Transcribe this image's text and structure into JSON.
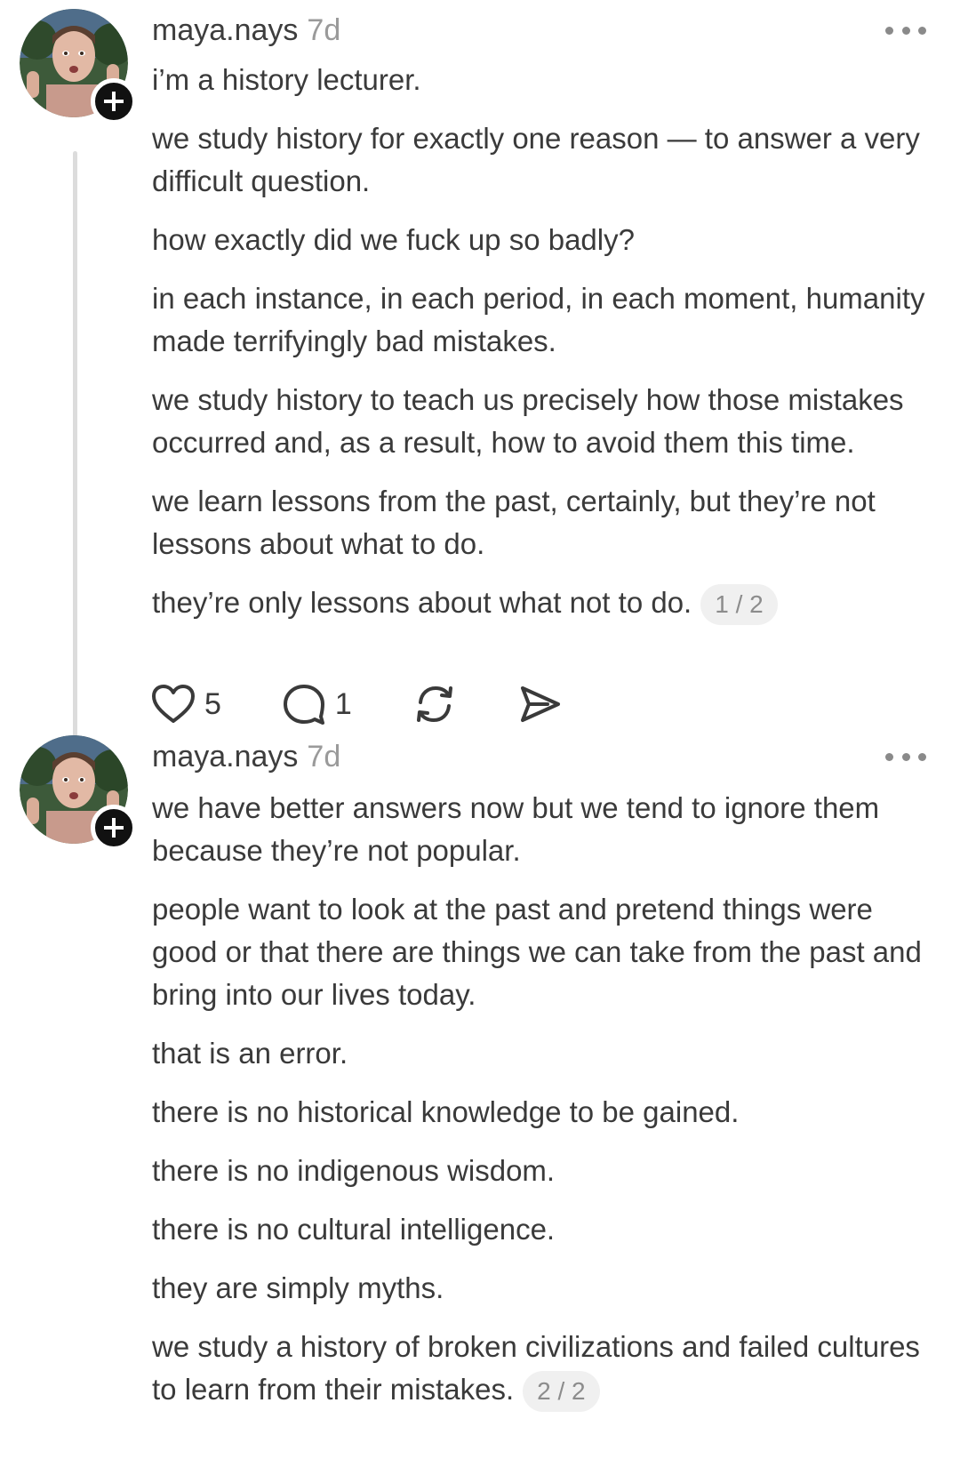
{
  "posts": [
    {
      "username": "maya.nays",
      "time": "7d",
      "paragraphs": [
        "i’m a history lecturer.",
        "we study history for exactly one reason — to answer a very difficult question.",
        "how exactly did we fuck up so badly?",
        "in each instance, in each period, in each moment, humanity made terrifyingly bad mistakes.",
        "we study history to teach us precisely how those mistakes occurred and, as a result, how to avoid them this time.",
        "we learn lessons from the past, certainly, but they’re not lessons about what to do.",
        "they’re only lessons about what not to do."
      ],
      "page_indicator": "1 / 2",
      "actions": {
        "like_icon": "heart-icon",
        "like_count": "5",
        "reply_icon": "comment-icon",
        "reply_count": "1",
        "repost_icon": "repost-icon",
        "share_icon": "send-icon"
      }
    },
    {
      "username": "maya.nays",
      "time": "7d",
      "paragraphs": [
        "we have better answers now but we tend to ignore them because they’re not popular.",
        "people want to look at the past and pretend things were good or that there are things we can take from the past and bring into our lives today.",
        "that is an error.",
        "there is no historical knowledge to be gained.",
        "there is no indigenous wisdom.",
        "there is no cultural intelligence.",
        "they are simply myths.",
        "we study a history of broken civilizations and failed cultures to learn from their mistakes."
      ],
      "page_indicator": "2 / 2"
    }
  ],
  "icons": {
    "follow": "plus-icon",
    "more": "more-options-icon"
  },
  "colors": {
    "text": "#3a3a3a",
    "muted": "#9a9a9a",
    "thread_line": "#dcdcdc",
    "badge": "#111111"
  }
}
